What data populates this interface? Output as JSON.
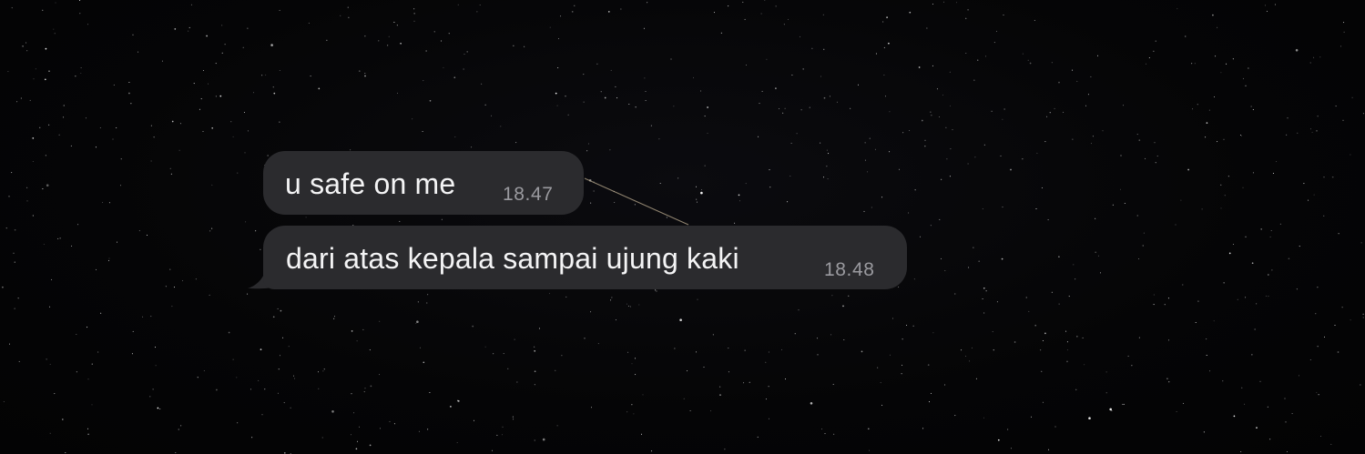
{
  "conversation": {
    "messages": [
      {
        "text": "u safe on me",
        "time": "18.47"
      },
      {
        "text": "dari atas kepala sampai ujung kaki",
        "time": "18.48"
      }
    ]
  },
  "colors": {
    "background": "#050506",
    "bubble": "#2b2b2e",
    "message_text": "#f4f4f5",
    "timestamp_text": "#9a9a9f",
    "stars": "#ffffff",
    "meteor_trail": "#c9b89a"
  }
}
